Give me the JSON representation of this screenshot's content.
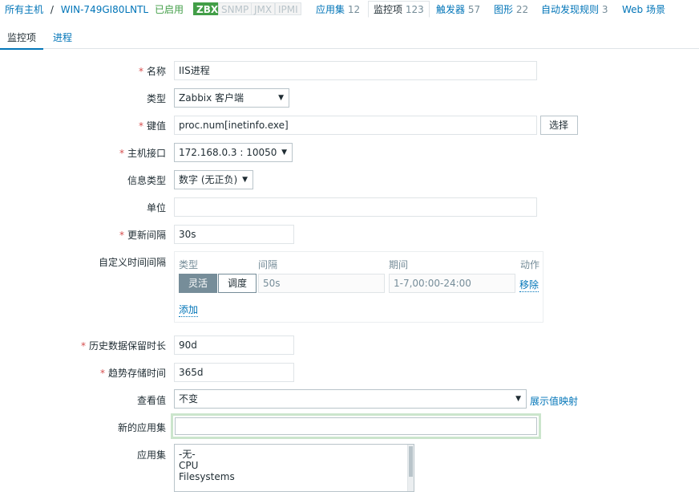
{
  "host_bar": {
    "all_hosts": "所有主机",
    "separator": "/",
    "host_name": "WIN-749GI80LNTL",
    "status": "已启用",
    "availability": [
      "ZBX",
      "SNMP",
      "JMX",
      "IPMI"
    ],
    "tabs": [
      {
        "label": "应用集",
        "count": "12"
      },
      {
        "label": "监控项",
        "count": "123"
      },
      {
        "label": "触发器",
        "count": "57"
      },
      {
        "label": "图形",
        "count": "22"
      },
      {
        "label": "自动发现规则",
        "count": "3"
      },
      {
        "label": "Web 场景",
        "count": ""
      }
    ]
  },
  "subtabs": {
    "item": "监控项",
    "process": "进程"
  },
  "form": {
    "name": {
      "label": "名称",
      "value": "IIS进程"
    },
    "type": {
      "label": "类型",
      "value": "Zabbix 客户端"
    },
    "key": {
      "label": "键值",
      "value": "proc.num[inetinfo.exe]",
      "select_button": "选择"
    },
    "host_interface": {
      "label": "主机接口",
      "value": "172.168.0.3 : 10050"
    },
    "info_type": {
      "label": "信息类型",
      "value": "数字 (无正负)"
    },
    "units": {
      "label": "单位",
      "value": ""
    },
    "update_interval": {
      "label": "更新间隔",
      "value": "30s"
    },
    "custom_intervals": {
      "label": "自定义时间间隔",
      "headers": {
        "type": "类型",
        "interval": "间隔",
        "period": "期间",
        "action": "动作"
      },
      "row": {
        "flexible": "灵活",
        "scheduling": "调度",
        "interval_placeholder": "50s",
        "period_placeholder": "1-7,00:00-24:00",
        "remove": "移除"
      },
      "add": "添加"
    },
    "history": {
      "label": "历史数据保留时长",
      "value": "90d"
    },
    "trends": {
      "label": "趋势存储时间",
      "value": "365d"
    },
    "show_value": {
      "label": "查看值",
      "value": "不变",
      "mapping_link": "展示值映射"
    },
    "new_application": {
      "label": "新的应用集",
      "value": ""
    },
    "applications": {
      "label": "应用集",
      "options": [
        "-无-",
        "CPU",
        "Filesystems"
      ]
    }
  },
  "colors": {
    "link": "#0275b8",
    "enabled": "#429e47",
    "required": "#d64e4e"
  }
}
